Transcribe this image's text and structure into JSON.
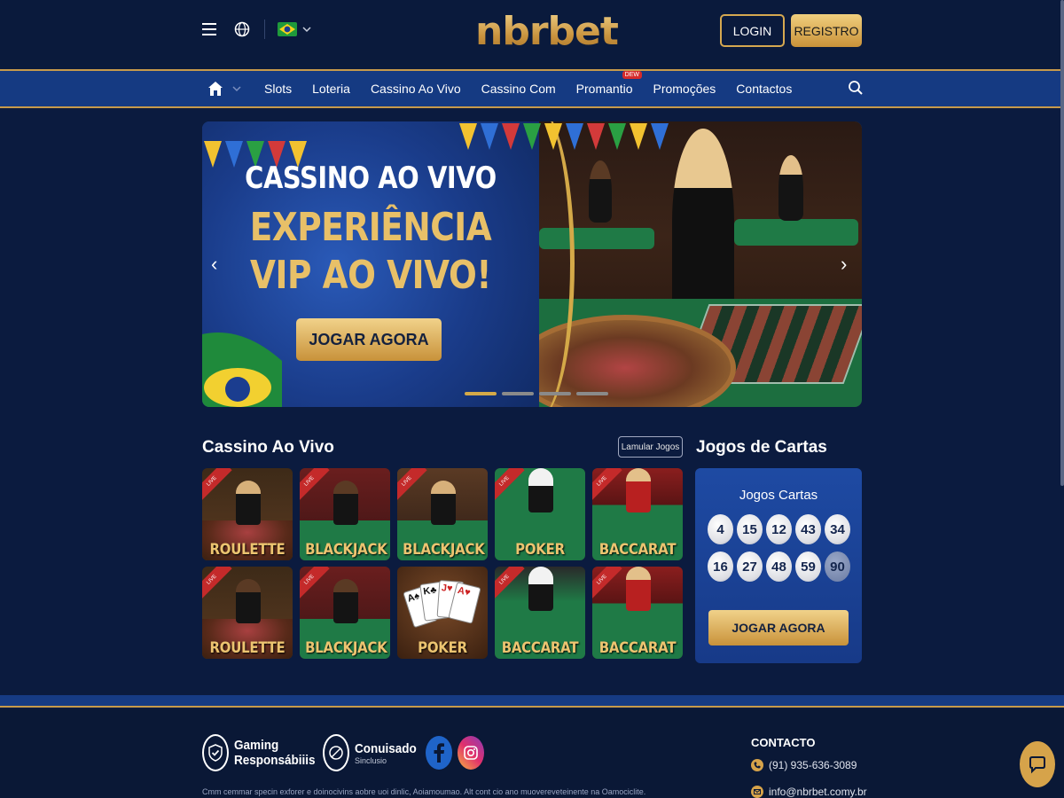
{
  "header": {
    "logo": "nbrbet",
    "login_label": "LOGIN",
    "register_label": "REGISTRO",
    "language_icon": "globe-icon",
    "flag": "brazil-flag"
  },
  "nav": {
    "items": [
      {
        "label": "Slots"
      },
      {
        "label": "Loteria"
      },
      {
        "label": "Cassino Ao Vivo"
      },
      {
        "label": "Cassino Com"
      },
      {
        "label": "Promantio",
        "badge": "DEW"
      },
      {
        "label": "Promoções"
      },
      {
        "label": "Contactos"
      }
    ]
  },
  "banner": {
    "line1": "CASSINO AO VIVO",
    "line2": "EXPERIÊNCIA",
    "line3": "VIP AO VIVO!",
    "cta": "JOGAR AGORA",
    "slides": 4,
    "active_slide": 1
  },
  "live_casino": {
    "title": "Cassino Ao Vivo",
    "button": "Lamular Jogos",
    "games": [
      {
        "label": "ROULETTE",
        "tag": "LIVE"
      },
      {
        "label": "BLACKJACK",
        "tag": "LIVE"
      },
      {
        "label": "BLACKJACK",
        "tag": "LIVE"
      },
      {
        "label": "POKER",
        "tag": "LIVE"
      },
      {
        "label": "BACCARAT",
        "tag": "LIVE"
      },
      {
        "label": "ROULETTE",
        "tag": "LIVE"
      },
      {
        "label": "BLACKJACK",
        "tag": "LIVE"
      },
      {
        "label": "POKER",
        "tag": ""
      },
      {
        "label": "BACCARAT",
        "tag": "LIVE"
      },
      {
        "label": "BACCARAT",
        "tag": "LIVE"
      }
    ]
  },
  "card_games": {
    "title": "Jogos de Cartas",
    "panel_title": "Jogos Cartas",
    "numbers": [
      "4",
      "15",
      "12",
      "43",
      "34",
      "16",
      "27",
      "48",
      "59",
      "90"
    ],
    "cta": "JOGAR AGORA"
  },
  "footer": {
    "badge1_line1": "Gaming",
    "badge1_line2": "Responsábiiis",
    "badge2_line1": "Conuisado",
    "badge2_line2": "Sinclusio",
    "disclaimer": "Cmm cemmar specin exforer e doinocivins aobre uoi dinlic, Aoiamoumao. Alt cont cio ano muovereveteinente na Oamociclite.",
    "contact_title": "CONTACTO",
    "phone": "(91) 935-636-3089",
    "email": "info@nbrbet.comy.br"
  },
  "colors": {
    "background": "#0b1b3f",
    "nav": "#153a82",
    "gold": "#d5a850"
  }
}
